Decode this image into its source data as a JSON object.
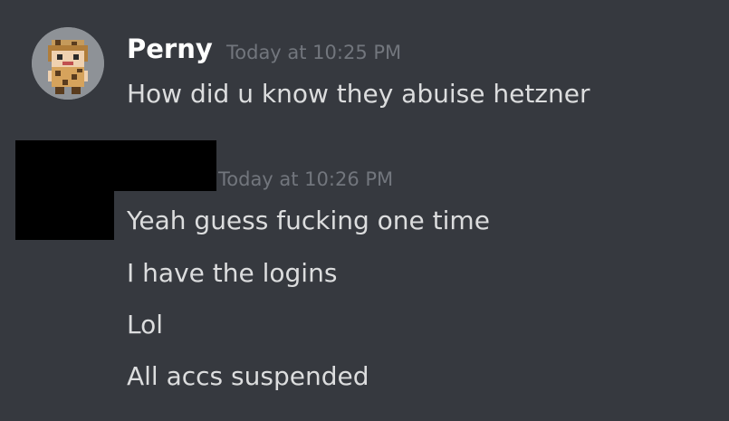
{
  "messages": [
    {
      "author": "Perny",
      "timestamp": "Today at 10:25 PM",
      "lines": [
        "How did u know they abuise hetzner"
      ]
    },
    {
      "author": "",
      "timestamp": "Today at 10:26 PM",
      "lines": [
        "Yeah guess fucking one time",
        "I have the logins",
        "Lol",
        "All accs suspended"
      ]
    }
  ],
  "icons": {
    "avatar": "pixel-character-avatar"
  },
  "colors": {
    "background": "#36393f",
    "author": "#ffffff",
    "timestamp": "#72767d",
    "message_text": "#dcddde",
    "redaction": "#000000"
  }
}
